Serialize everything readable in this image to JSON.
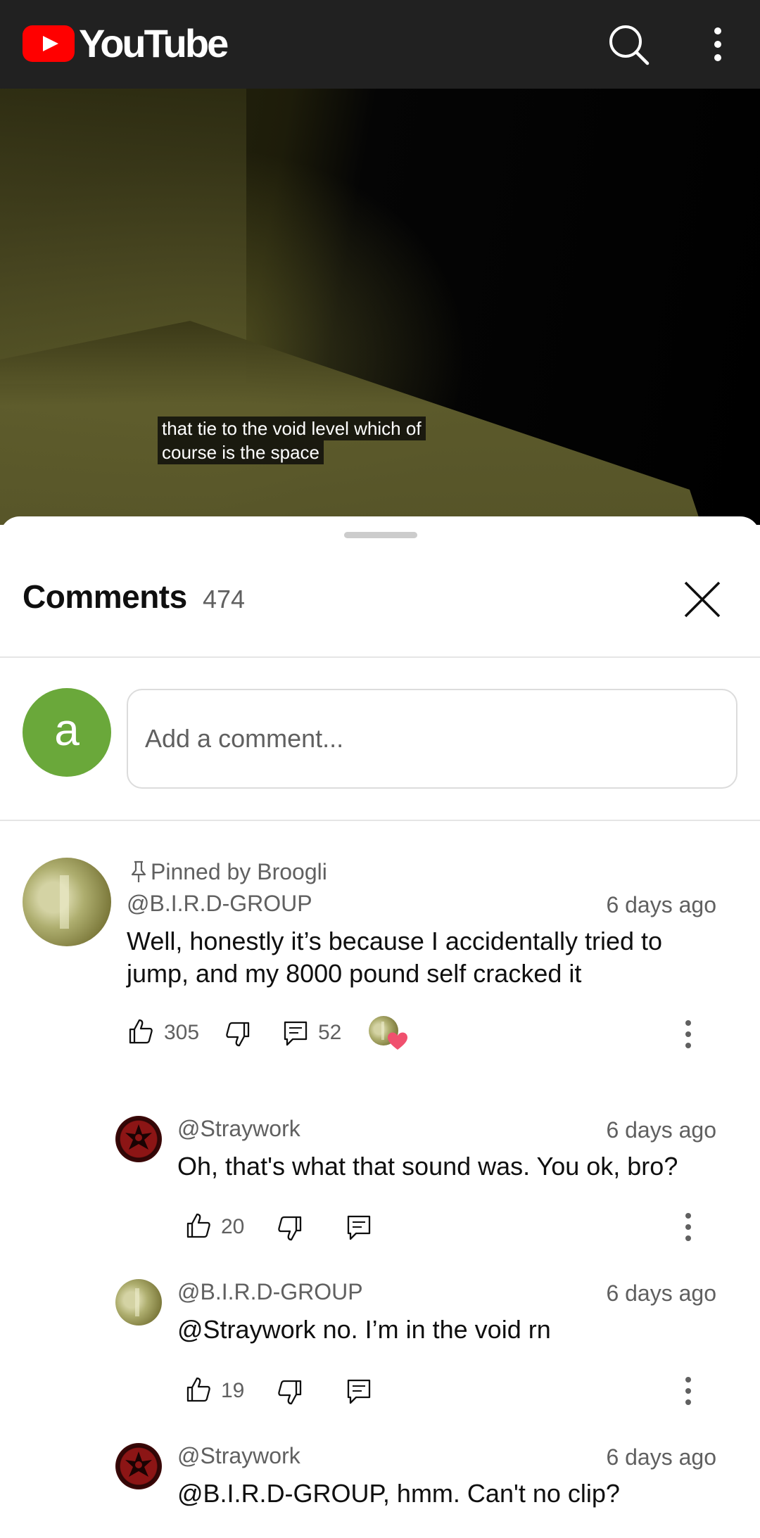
{
  "topbar": {
    "logo_text": "YouTube",
    "search_icon": "search-icon",
    "more_icon": "more-vertical-icon",
    "brand_red": "#ff0000",
    "bg_color": "#212121"
  },
  "video": {
    "caption_line1": "that tie to the void level which of",
    "caption_line2": "course is the space"
  },
  "comments_panel": {
    "title": "Comments",
    "count": "474",
    "close_icon": "close-icon",
    "user_avatar_letter": "a",
    "input_placeholder": "Add a comment..."
  },
  "pinned_comment": {
    "pinned_label": "Pinned by Broogli",
    "author": "@B.I.R.D-GROUP",
    "time": "6 days ago",
    "text_line1": "Well, honestly it’s because I accidentally tried to",
    "text_line2": "jump, and my 8000 pound self cracked it",
    "likes": "305",
    "replies": "52"
  },
  "replies": [
    {
      "author": "@Straywork",
      "time": "6 days ago",
      "text": "Oh, that's what that sound was. You ok, bro?",
      "likes": "20"
    },
    {
      "author": "@B.I.R.D-GROUP",
      "time": "6 days ago",
      "text": "@Straywork no. I’m in the void rn",
      "likes": "19"
    },
    {
      "author": "@Straywork",
      "time": "6 days ago",
      "text": "@B.I.R.D-GROUP, hmm. Can't no clip?"
    }
  ]
}
